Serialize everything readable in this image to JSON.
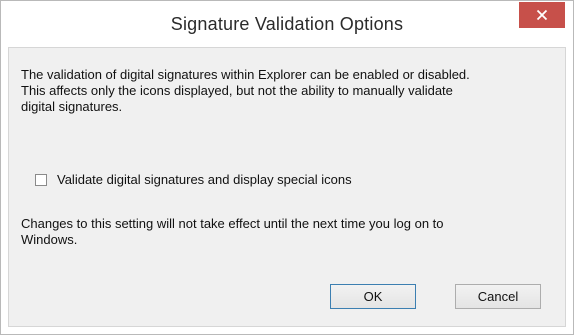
{
  "window": {
    "title": "Signature Validation Options",
    "close_icon": "close-icon",
    "close_color": "#c7504a"
  },
  "content": {
    "description_line1": "The validation of digital signatures within Explorer can be enabled or disabled.",
    "description_line2": "This affects only the icons displayed, but not the ability to manually validate",
    "description_line3": "digital signatures.",
    "checkbox_label": "Validate digital signatures and display special icons",
    "checkbox_checked": false,
    "note_line1": "Changes to this setting will not take effect until the next time you log on to",
    "note_line2": "Windows."
  },
  "buttons": {
    "ok_label": "OK",
    "cancel_label": "Cancel"
  }
}
